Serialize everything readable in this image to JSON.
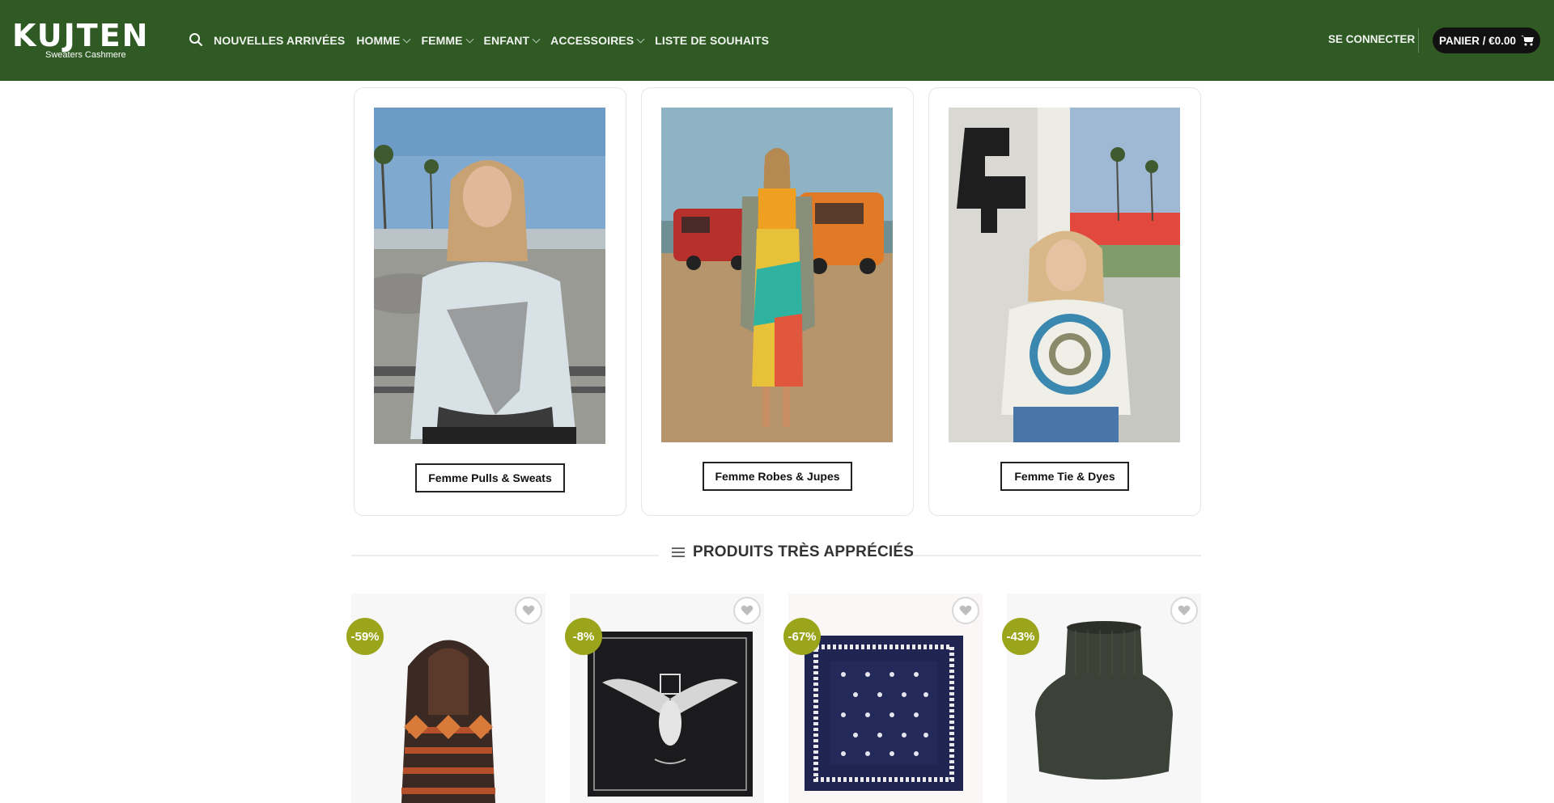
{
  "header": {
    "logo_text": "KUJTEN",
    "logo_tagline": "Sweaters Cashmere",
    "search_icon": "search-icon",
    "nav": [
      {
        "label": "NOUVELLES ARRIVÉES",
        "dropdown": false
      },
      {
        "label": "HOMME",
        "dropdown": true
      },
      {
        "label": "FEMME",
        "dropdown": true
      },
      {
        "label": "ENFANT",
        "dropdown": true
      },
      {
        "label": "ACCESSOIRES",
        "dropdown": true
      },
      {
        "label": "LISTE DE SOUHAITS",
        "dropdown": false
      }
    ],
    "login_label": "SE CONNECTER",
    "cart_label": "PANIER / €0.00",
    "cart_icon": "cart-icon",
    "bg_color": "#2f5a24"
  },
  "categories": [
    {
      "label": "Femme Pulls & Sweats"
    },
    {
      "label": "Femme Robes & Jupes"
    },
    {
      "label": "Femme Tie & Dyes"
    }
  ],
  "section": {
    "title": "PRODUITS TRÈS APPRÉCIÉS",
    "icon": "list-icon"
  },
  "products": [
    {
      "badge": "-59%",
      "kind": "knit hood"
    },
    {
      "badge": "-8%",
      "kind": "eagle scarf"
    },
    {
      "badge": "-67%",
      "kind": "bandana scarf"
    },
    {
      "badge": "-43%",
      "kind": "snood"
    }
  ],
  "colors": {
    "badge": "#9aa51b",
    "accent_dark": "#111111"
  }
}
